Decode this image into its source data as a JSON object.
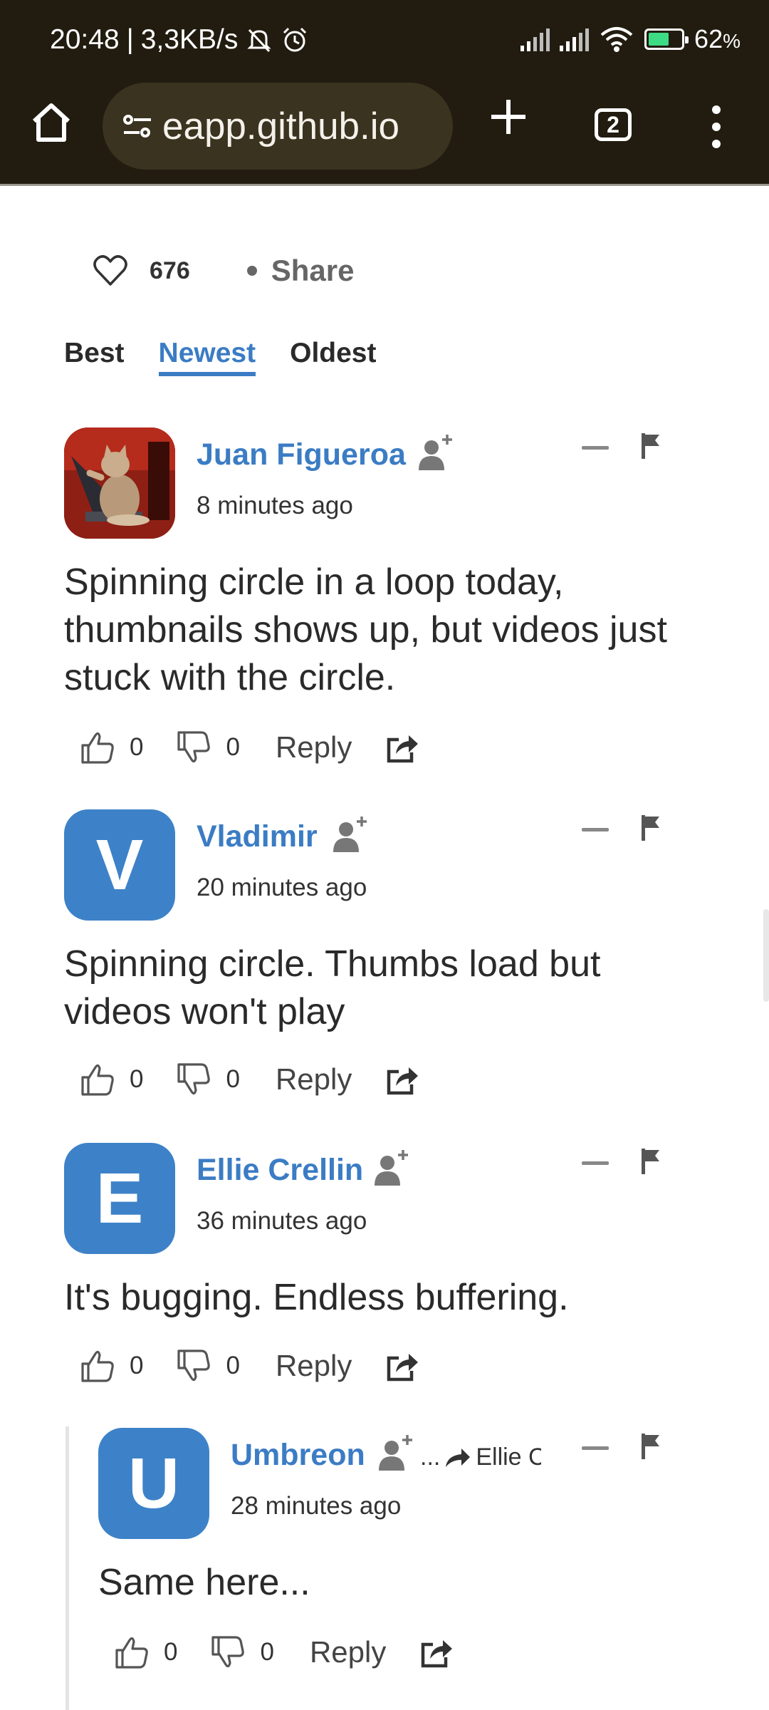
{
  "status_bar": {
    "time": "20:48",
    "speed": "3,3KB/s",
    "battery": "62",
    "battery_unit": "%"
  },
  "browser": {
    "url": "eapp.github.io",
    "tab_count": "2"
  },
  "post": {
    "likes": "676",
    "share_label": "Share"
  },
  "sort_tabs": [
    "Best",
    "Newest",
    "Oldest"
  ],
  "sort_active": "Newest",
  "comments": [
    {
      "author": "Juan Figueroa",
      "time": "8 minutes ago",
      "text": "Spinning circle in a loop today, thumbnails shows up, but videos just stuck with the circle.",
      "upvotes": "0",
      "downvotes": "0",
      "reply_label": "Reply",
      "avatar": "cat-photo"
    },
    {
      "author": "Vladimir",
      "time": "20 minutes ago",
      "text": "Spinning circle. Thumbs load but videos won't play",
      "upvotes": "0",
      "downvotes": "0",
      "reply_label": "Reply",
      "avatar_letter": "V"
    },
    {
      "author": "Ellie Crellin",
      "time": "36 minutes ago",
      "text": "It's bugging. Endless buffering.",
      "upvotes": "0",
      "downvotes": "0",
      "reply_label": "Reply",
      "avatar_letter": "E"
    },
    {
      "author": "Umbreon",
      "time": "28 minutes ago",
      "in_reply_to": "Ellie C",
      "in_reply_prefix": "...",
      "text": "Same here...",
      "upvotes": "0",
      "downvotes": "0",
      "reply_label": "Reply",
      "avatar_letter": "U"
    }
  ],
  "colors": {
    "accent": "#3b7cc4",
    "avatar_bg": "#3d82c8",
    "chrome_bg": "#221c10",
    "url_bar_bg": "#3a3320"
  }
}
